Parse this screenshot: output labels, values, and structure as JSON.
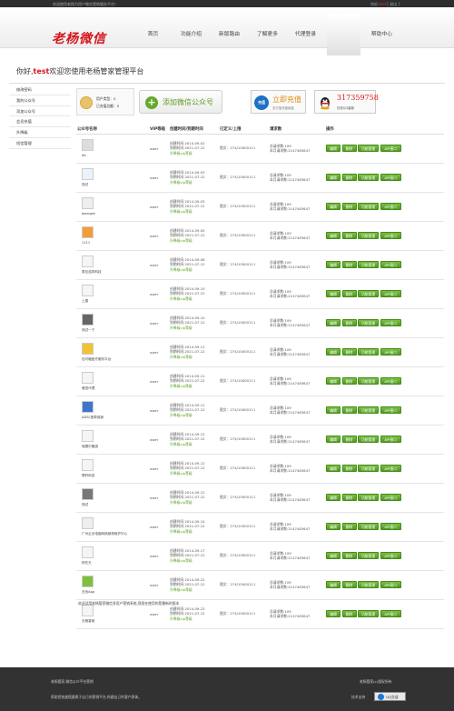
{
  "topbar": {
    "welcome": "欢迎使用老杨为用户微信营销服务平台！",
    "user_prefix": "你好,",
    "user": "test",
    "logout": "[ 退出 ]"
  },
  "logo": "老杨微信",
  "nav": [
    "首页",
    "功能介绍",
    "新版路由",
    "了解更多",
    "代理登录",
    "",
    "帮助中心"
  ],
  "greeting": {
    "prefix": "你好,",
    "user": "test",
    "suffix": "欢迎您使用老杨管家管理平台"
  },
  "sidebar": [
    "修改密码",
    "我的公众号",
    "添加公众号",
    "会员充值",
    "升降级",
    "短信管理"
  ],
  "account_info": {
    "line1": "用户类型：0",
    "line2": "已充值总额：0"
  },
  "add_button": "添加微信公众号",
  "recharge": {
    "icon": "充值",
    "title": "立即充值",
    "subtitle": "支付宝充值续费"
  },
  "qq": {
    "number": "317359758",
    "subtitle": "在线QQ客服"
  },
  "table": {
    "headers": [
      "公众号名称",
      "VIP等级",
      "创建时间/到期时间",
      "已定义/上限",
      "请求数",
      "操作"
    ],
    "rows": [
      {
        "name": "dd",
        "vip": "ower",
        "created": "创建时间:2014-09-02",
        "expire": "到期时间:2021-07-12",
        "upgrade": "升降级vip等级",
        "limit": "图文：274/10000111",
        "req1": "总请求数:109",
        "req2": "本月请求数:2147483647"
      },
      {
        "name": "测试",
        "vip": "ower",
        "created": "创建时间:2014-09-03",
        "expire": "到期时间:2021-07-12",
        "upgrade": "升降级vip等级",
        "limit": "图文：274/10000111",
        "req1": "总请求数:109",
        "req2": "本月请求数:2147483647"
      },
      {
        "name": "qweqwe",
        "vip": "ower",
        "created": "创建时间:2014-09-03",
        "expire": "到期时间:2021-07-12",
        "upgrade": "升降级vip等级",
        "limit": "图文：274/10000111",
        "req1": "总请求数:109",
        "req2": "本月请求数:2147483647"
      },
      {
        "name": "1111",
        "vip": "ower",
        "created": "创建时间:2014-09-05",
        "expire": "到期时间:2021-07-12",
        "upgrade": "升降级vip等级",
        "limit": "图文：274/10000111",
        "req1": "总请求数:109",
        "req2": "本月请求数:2147483647"
      },
      {
        "name": "泰应浩同科技",
        "vip": "ower",
        "created": "创建时间:2014-09-08",
        "expire": "到期时间:2021-07-12",
        "upgrade": "升降级vip等级",
        "limit": "图文：274/10000111",
        "req1": "总请求数:109",
        "req2": "本月请求数:2147483647"
      },
      {
        "name": "上善",
        "vip": "ower",
        "created": "创建时间:2014-09-10",
        "expire": "到期时间:2021-07-12",
        "upgrade": "升降级vip等级",
        "limit": "图文：274/10000111",
        "req1": "总请求数:109",
        "req2": "本月请求数:2147483647"
      },
      {
        "name": "测试一下",
        "vip": "ower",
        "created": "创建时间:2014-09-10",
        "expire": "到期时间:2021-07-12",
        "upgrade": "升降级vip等级",
        "limit": "图文：274/10000111",
        "req1": "总请求数:109",
        "req2": "本月请求数:2147483647"
      },
      {
        "name": "佳可辐医疗服务平台",
        "vip": "ower",
        "created": "创建时间:2014-09-11",
        "expire": "到期时间:2021-07-12",
        "upgrade": "升降级vip等级",
        "limit": "图文：274/10000111",
        "req1": "总请求数:109",
        "req2": "本月请求数:2147483647"
      },
      {
        "name": "雅田代理",
        "vip": "ower",
        "created": "创建时间:2014-09-11",
        "expire": "到期时间:2021-07-12",
        "upgrade": "升降级vip等级",
        "limit": "图文：274/10000111",
        "req1": "总请求数:109",
        "req2": "本月请求数:2147483647"
      },
      {
        "name": "ADSL宽带促销",
        "vip": "ower",
        "created": "创建时间:2014-09-11",
        "expire": "到期时间:2021-07-12",
        "upgrade": "升降级vip等级",
        "limit": "图文：274/10000111",
        "req1": "总请求数:109",
        "req2": "本月请求数:2147483647"
      },
      {
        "name": "瑞德尔集团",
        "vip": "ower",
        "created": "创建时间:2014-09-12",
        "expire": "到期时间:2021-07-12",
        "upgrade": "升降级vip等级",
        "limit": "图文：274/10000111",
        "req1": "总请求数:109",
        "req2": "本月请求数:2147483647"
      },
      {
        "name": "联轩科技",
        "vip": "ower",
        "created": "创建时间:2014-09-12",
        "expire": "到期时间:2021-07-12",
        "upgrade": "升降级vip等级",
        "limit": "图文：274/10000111",
        "req1": "总请求数:109",
        "req2": "本月请求数:2147483647"
      },
      {
        "name": "测试",
        "vip": "ower",
        "created": "创建时间:2014-09-12",
        "expire": "到期时间:2021-07-12",
        "upgrade": "升降级vip等级",
        "limit": "图文：274/10000111",
        "req1": "总请求数:109",
        "req2": "本月请求数:2147483647"
      },
      {
        "name": "广州企业电脑网络维修维护中心",
        "vip": "ower",
        "created": "创建时间:2014-09-14",
        "expire": "到期时间:2021-07-12",
        "upgrade": "升降级vip等级",
        "limit": "图文：274/10000111",
        "req1": "总请求数:109",
        "req2": "本月请求数:2147483647"
      },
      {
        "name": "阿在天",
        "vip": "ower",
        "created": "创建时间:2014-09-17",
        "expire": "到期时间:2021-07-12",
        "upgrade": "升降级vip等级",
        "limit": "图文：274/10000111",
        "req1": "总请求数:109",
        "req2": "本月请求数:2147483647"
      },
      {
        "name": "无优App",
        "vip": "ower",
        "created": "创建时间:2014-09-22",
        "expire": "到期时间:2021-07-12",
        "upgrade": "升降级vip等级",
        "limit": "图文：274/10000111",
        "req1": "总请求数:109",
        "req2": "本月请求数:2147483647"
      },
      {
        "name": "天雅香姬",
        "vip": "ower",
        "created": "创建时间:2014-09-23",
        "expire": "到期时间:2021-07-12",
        "upgrade": "升降级vip等级",
        "limit": "图文：274/10000111",
        "req1": "总请求数:109",
        "req2": "本月请求数:2147483647"
      }
    ],
    "actions": [
      "编辑",
      "删除",
      "功能管理",
      "API接口"
    ]
  },
  "note": "欢迎试用老杨管家微信多用户营销系统,我现在使用的是最新的版本",
  "footer": {
    "left1": "老杨管家,微信公众平台营销",
    "left2": "帮助您快速搭建属于自己的营销平台,构建自己的客户群体。",
    "right1": "老杨管家(c)版权所有",
    "right2": "技术支持",
    "qq": "QQ交谈"
  }
}
